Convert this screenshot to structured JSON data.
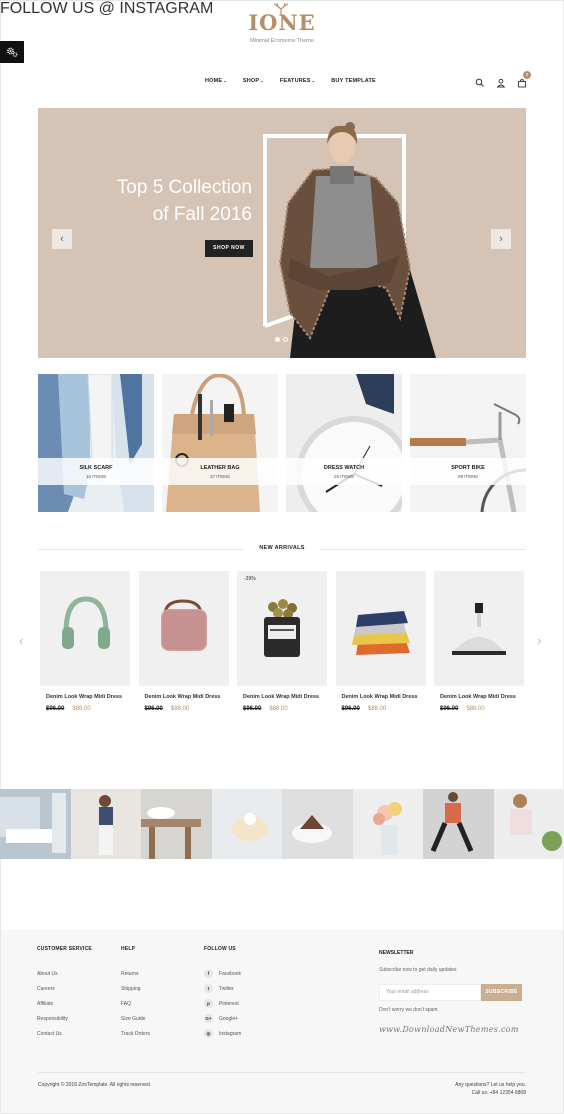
{
  "brand": {
    "logo_text": "IONE",
    "tagline": "Minimal Ecomerce Theme",
    "accent": "#b49068"
  },
  "nav": {
    "items": [
      {
        "label": "HOME",
        "has_dropdown": true
      },
      {
        "label": "SHOP",
        "has_dropdown": true
      },
      {
        "label": "FEATURES",
        "has_dropdown": true
      },
      {
        "label": "BUY TEMPLATE",
        "has_dropdown": false
      }
    ],
    "cart_count": "0",
    "icons": [
      "search-icon",
      "user-icon",
      "cart-icon"
    ]
  },
  "hero": {
    "title_line1": "Top 5 Collection",
    "title_line2": "of Fall 2016",
    "button": "SHOP NOW",
    "bg": "#d5c3b5",
    "slides": 2,
    "active_slide": 1
  },
  "categories": [
    {
      "name": "SILK SCARF",
      "count": "16 ITEMS"
    },
    {
      "name": "LEATHER BAG",
      "count": "37 ITEMS"
    },
    {
      "name": "DRESS WATCH",
      "count": "25 ITEMS"
    },
    {
      "name": "SPORT BIKE",
      "count": "09 ITEMS"
    }
  ],
  "new_arrivals": {
    "heading": "NEW ARRIVALS",
    "products": [
      {
        "name": "Denim Look Wrap Midi Dress",
        "old_price": "$96.00",
        "price": "$88.00",
        "sale": "",
        "icon": "headphones-icon"
      },
      {
        "name": "Denim Look Wrap Midi Dress",
        "old_price": "$96.00",
        "price": "$88.00",
        "sale": "",
        "icon": "speaker-icon"
      },
      {
        "name": "Denim Look Wrap Midi Dress",
        "old_price": "$96.00",
        "price": "$88.00",
        "sale": "-39%",
        "icon": "jar-icon"
      },
      {
        "name": "Denim Look Wrap Midi Dress",
        "old_price": "$96.00",
        "price": "$88.00",
        "sale": "",
        "icon": "pillows-icon"
      },
      {
        "name": "Denim Look Wrap Midi Dress",
        "old_price": "$96.00",
        "price": "$88.00",
        "sale": "",
        "icon": "decanter-icon"
      }
    ]
  },
  "instagram": {
    "label": "FOLLOW US @ INSTAGRAM"
  },
  "footer": {
    "customer_service": {
      "heading": "CUSTOMER SERVICE",
      "links": [
        "About Us",
        "Careers",
        "Affiliate",
        "Responsibility",
        "Contact Us"
      ]
    },
    "help": {
      "heading": "HELP",
      "links": [
        "Returns",
        "Shipping",
        "FAQ",
        "Size Guide",
        "Track Orders"
      ]
    },
    "follow": {
      "heading": "FOLLOW US",
      "links": [
        {
          "label": "Facebook",
          "icon": "facebook-icon",
          "glyph": "f"
        },
        {
          "label": "Twitter",
          "icon": "twitter-icon",
          "glyph": "t"
        },
        {
          "label": "Pinterest",
          "icon": "pinterest-icon",
          "glyph": "p"
        },
        {
          "label": "Google+",
          "icon": "google-plus-icon",
          "glyph": "G+"
        },
        {
          "label": "Instagram",
          "icon": "instagram-icon",
          "glyph": "◎"
        }
      ]
    },
    "newsletter": {
      "heading": "NEWSLETTER",
      "subtitle": "Subscribe now to get daily updates",
      "placeholder": "Your email address",
      "button": "SUBSCRIBE",
      "note": "Don't worry we don't spam"
    },
    "watermark": "www.DownloadNewThemes.com",
    "copyright": "Copyright © 2016 ZooTemplate. All rights reserved.",
    "help_line1": "Any questions? Let us help you.",
    "help_line2": "Call us: +84 12354 6868"
  }
}
